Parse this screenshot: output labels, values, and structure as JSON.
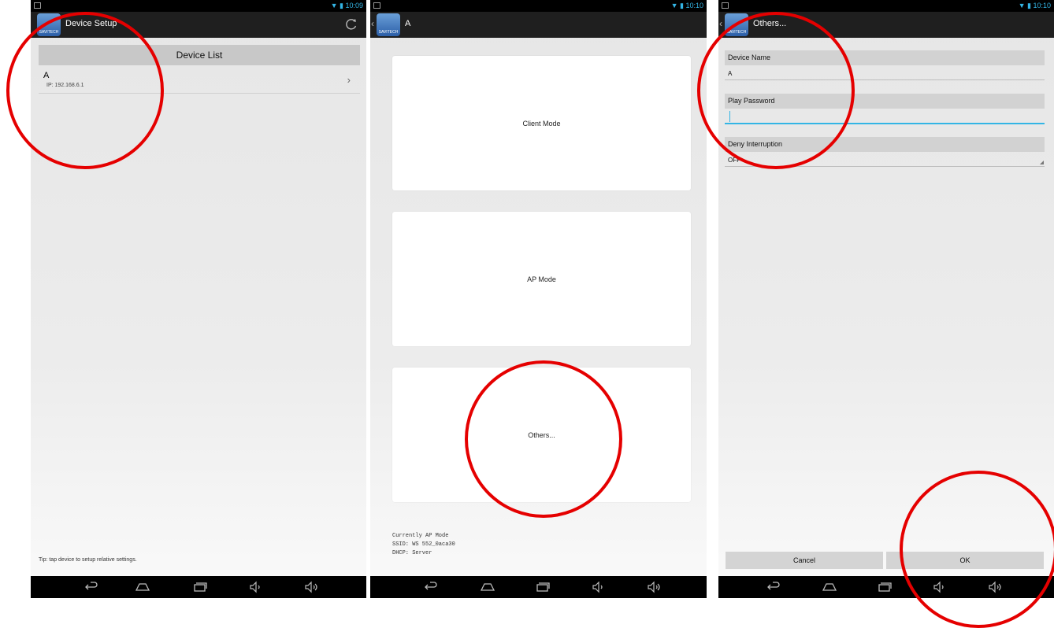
{
  "panel1": {
    "status_time": "10:09",
    "title": "Device Setup",
    "list_header": "Device List",
    "devices": [
      {
        "name": "A",
        "ip": "IP: 192.168.6.1"
      }
    ],
    "tip": "Tip: tap device to setup relative settings."
  },
  "panel2": {
    "status_time": "10:10",
    "title": "A",
    "modes": [
      "Client Mode",
      "AP Mode",
      "Others..."
    ],
    "info": [
      "Currently AP Mode",
      "SSID: WS 552_0aca30",
      "DHCP: Server"
    ]
  },
  "panel3": {
    "status_time": "10:10",
    "title": "Others...",
    "device_name_label": "Device Name",
    "device_name_value": "A",
    "play_password_label": "Play Password",
    "play_password_value": "",
    "deny_interruption_label": "Deny Interruption",
    "deny_interruption_value": "OFF",
    "cancel_label": "Cancel",
    "ok_label": "OK"
  },
  "app_logo_text": "SAVITECH",
  "colors": {
    "annotation": "#e50000",
    "accent": "#33b5e5",
    "actionbar": "#1f1f1f"
  },
  "icons": [
    "back-icon",
    "home-icon",
    "recent-apps-icon",
    "volume-down-icon",
    "volume-up-icon",
    "refresh-icon",
    "wifi-icon",
    "battery-icon"
  ]
}
